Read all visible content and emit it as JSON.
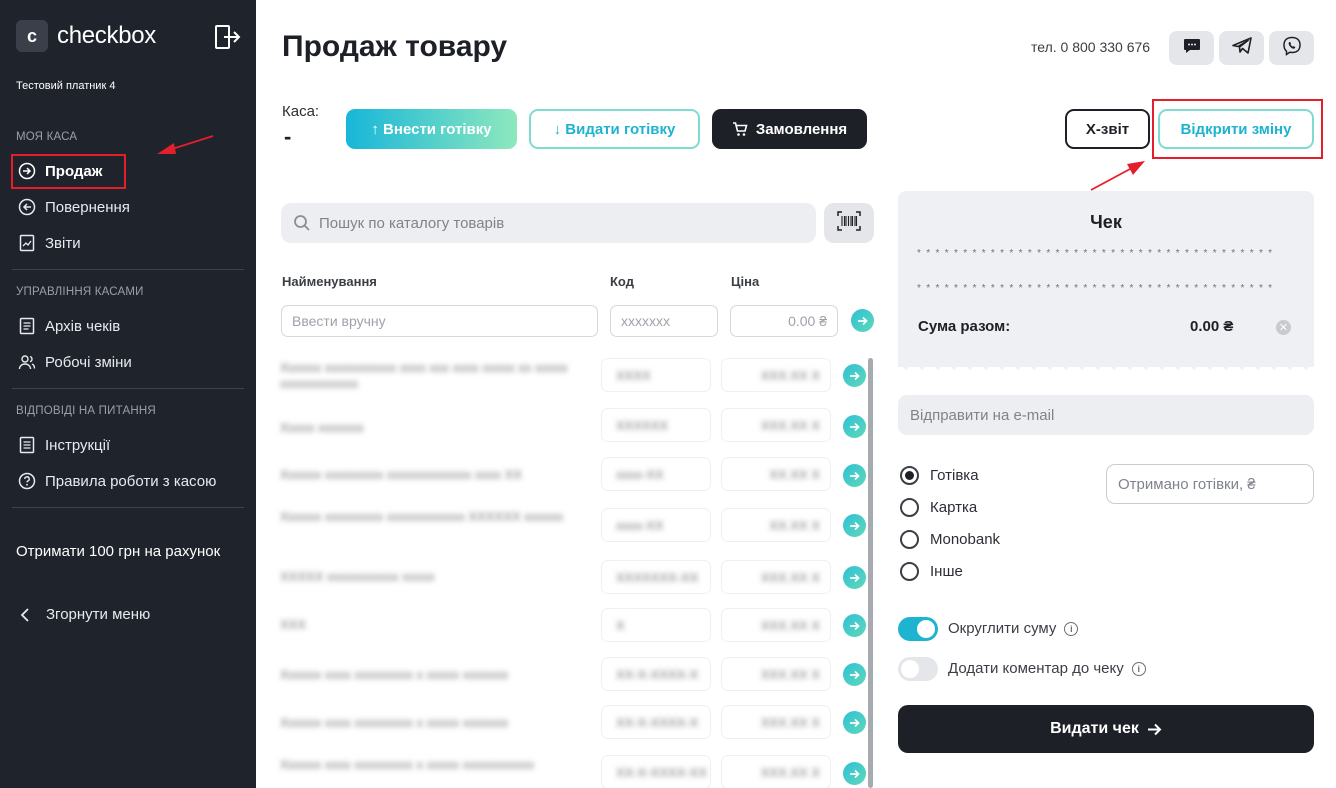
{
  "sidebar": {
    "logo_letter": "c",
    "logo_text": "checkbox",
    "payer": "Тестовий платник 4",
    "sections": [
      {
        "title": "МОЯ КАСА",
        "items": [
          {
            "label": "Продаж",
            "icon": "arrow-right-circle-icon"
          },
          {
            "label": "Повернення",
            "icon": "arrow-left-circle-icon"
          },
          {
            "label": "Звіти",
            "icon": "report-icon"
          }
        ]
      },
      {
        "title": "УПРАВЛІННЯ КАСАМИ",
        "items": [
          {
            "label": "Архів чеків",
            "icon": "archive-icon"
          },
          {
            "label": "Робочі зміни",
            "icon": "users-icon"
          }
        ]
      },
      {
        "title": "ВІДПОВІДІ НА ПИТАННЯ",
        "items": [
          {
            "label": "Інструкції",
            "icon": "document-icon"
          },
          {
            "label": "Правила роботи з касою",
            "icon": "question-icon"
          }
        ]
      }
    ],
    "promo": "Отримати 100 грн на рахунок",
    "collapse": "Згорнути меню"
  },
  "header": {
    "title": "Продаж товару",
    "phone": "тел. 0 800 330 676",
    "icons": [
      "chat-icon",
      "telegram-icon",
      "viber-icon"
    ]
  },
  "kasa": {
    "label": "Каса:",
    "value": "-"
  },
  "actions": {
    "deposit": "↑ Внести готівку",
    "withdraw": "↓ Видати готівку",
    "orders": "Замовлення",
    "x_report": "X-звіт",
    "open_shift": "Відкрити зміну"
  },
  "search": {
    "placeholder": "Пошук по каталогу товарів"
  },
  "table": {
    "headers": {
      "name": "Найменування",
      "code": "Код",
      "price": "Ціна"
    },
    "manual": {
      "name_placeholder": "Ввести вручну",
      "code_placeholder": "xxxxxxx",
      "price_placeholder": "0.00 ₴"
    },
    "rows": [
      {
        "name": "Xxxxxx xxxxxxxxxxx xxxx xxx xxxx xxxxx xx xxxxx xxxxxxxxxxxx",
        "code": "XXXX",
        "price": "XXX.XX X"
      },
      {
        "name": "Xxxxx xxxxxxx",
        "code": "XXXXXX",
        "price": "XXX.XX X"
      },
      {
        "name": "Xxxxxx xxxxxxxxx xxxxxxxxxxxxx xxxx XX",
        "code": "xxxx-XX",
        "price": "XX.XX X"
      },
      {
        "name": "Xxxxxx xxxxxxxxx xxxxxxxxxxxx XXXXXX xxxxxx",
        "code": "xxxx-XX",
        "price": "XX.XX X"
      },
      {
        "name": "XXXXX xxxxxxxxxxx xxxxx",
        "code": "XXXXXXX-XX",
        "price": "XXX.XX X"
      },
      {
        "name": "XXX",
        "code": "X",
        "price": "XXX.XX X"
      },
      {
        "name": "Xxxxxx xxxx xxxxxxxxx x xxxxx xxxxxxx",
        "code": "XX-X-XXXX-X",
        "price": "XXX.XX X"
      },
      {
        "name": "Xxxxxx xxxx xxxxxxxxx x xxxxx xxxxxxx",
        "code": "XX-X-XXXX-X",
        "price": "XXX.XX X"
      },
      {
        "name": "Xxxxxx xxxx xxxxxxxxx x xxxxx xxxxxxxxxxx",
        "code": "XX-X-XXXX-XX",
        "price": "XXX.XX X"
      }
    ]
  },
  "receipt": {
    "title": "Чек",
    "dots": "***************************************",
    "sum_label": "Сума разом:",
    "sum_value": "0.00 ₴"
  },
  "email": {
    "placeholder": "Відправити на e-mail"
  },
  "payment": {
    "options": [
      "Готівка",
      "Картка",
      "Monobank",
      "Інше"
    ],
    "selected": "Готівка",
    "cash_placeholder": "Отримано готівки, ₴"
  },
  "toggles": [
    {
      "label": "Округлити суму",
      "on": true
    },
    {
      "label": "Додати коментар до чеку",
      "on": false
    }
  ],
  "issue": {
    "label": "Видати чек"
  },
  "colors": {
    "sidebar_bg": "#1f232c",
    "accent": "#1eb4cf",
    "dark": "#1e2027",
    "annotation": "#e3202a"
  }
}
